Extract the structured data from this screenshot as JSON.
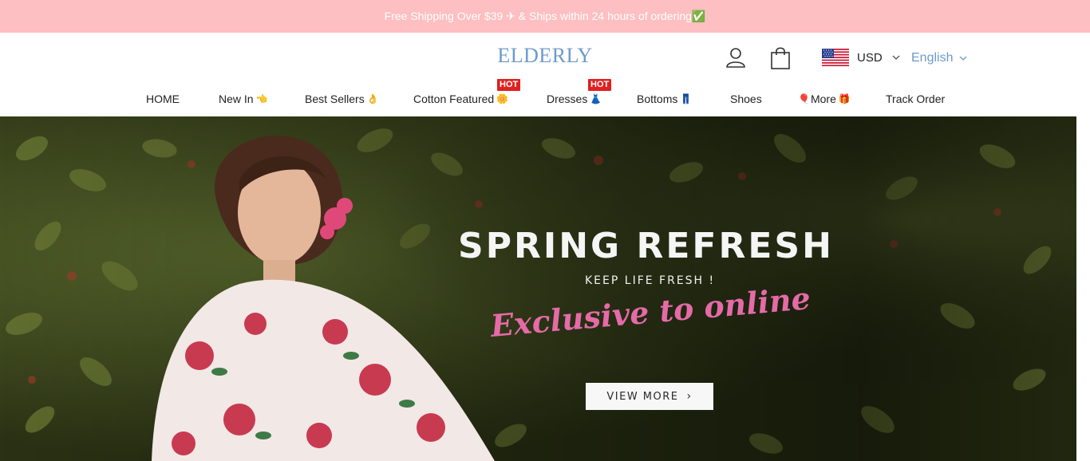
{
  "announcement": {
    "text": "Free Shipping Over $39 ✈ & Ships within 24 hours of ordering✅"
  },
  "header": {
    "logo": "ELDERLY",
    "icons": {
      "account": "user-icon",
      "cart": "shopping-bag-icon"
    },
    "currency": {
      "flag": "us-flag-icon",
      "label": "USD"
    },
    "language": {
      "label": "English"
    }
  },
  "nav": {
    "items": [
      {
        "label": "HOME",
        "emoji": ""
      },
      {
        "label": "New In",
        "emoji": "👈"
      },
      {
        "label": "Best Sellers",
        "emoji": "👌"
      },
      {
        "label": "Cotton Featured",
        "emoji": "🌼",
        "badge": "HOT"
      },
      {
        "label": "Dresses",
        "emoji": "👗",
        "badge": "HOT"
      },
      {
        "label": "Bottoms",
        "emoji": "👖"
      },
      {
        "label": "Shoes",
        "emoji": ""
      },
      {
        "label": "More",
        "emoji_before": "🎈",
        "emoji": "🎁"
      },
      {
        "label": "Track Order",
        "emoji": ""
      }
    ]
  },
  "hero": {
    "headline": "SPRING REFRESH",
    "subline": "KEEP LIFE FRESH !",
    "script": "Exclusive to online",
    "cta": "VIEW MORE",
    "cta_arrow": "›"
  },
  "colors": {
    "announcement_bg": "#fdbfc1",
    "logo": "#6d9bc9",
    "hot_badge": "#e0201f",
    "script_pink": "#e56aa8"
  }
}
